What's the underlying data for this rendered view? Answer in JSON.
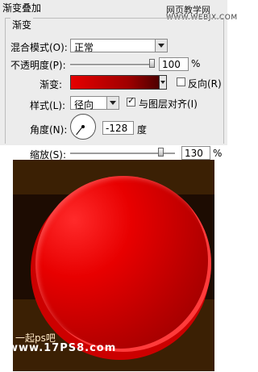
{
  "panel": {
    "title": "渐变叠加",
    "section_title": "渐变",
    "blend_mode": {
      "label": "混合模式(O):",
      "value": "正常"
    },
    "opacity": {
      "label": "不透明度(P):",
      "value": "100",
      "unit": "%",
      "slider_level": 1.0
    },
    "gradient": {
      "label": "渐变:",
      "reverse_label": "反向(R)",
      "reverse_checked": false
    },
    "style": {
      "label": "样式(L):",
      "value": "径向",
      "align_label": "与图层对齐(I)",
      "align_checked": true
    },
    "angle": {
      "label": "角度(N):",
      "value": "-128",
      "unit": "度"
    },
    "scale": {
      "label": "缩放(S):",
      "value": "130",
      "unit": "%",
      "slider_level": 0.62
    }
  },
  "watermark": {
    "top_line1": "网页教学网",
    "top_line2": "WWW.WEBJX.COM",
    "bottom_line1": "一起ps吧",
    "bottom_line2": "www.17PS8.com"
  },
  "colors": {
    "gradient_start": "#e60000",
    "gradient_end": "#3a0000",
    "canvas_bg": "#3b2004",
    "ball": "#cc0000"
  }
}
